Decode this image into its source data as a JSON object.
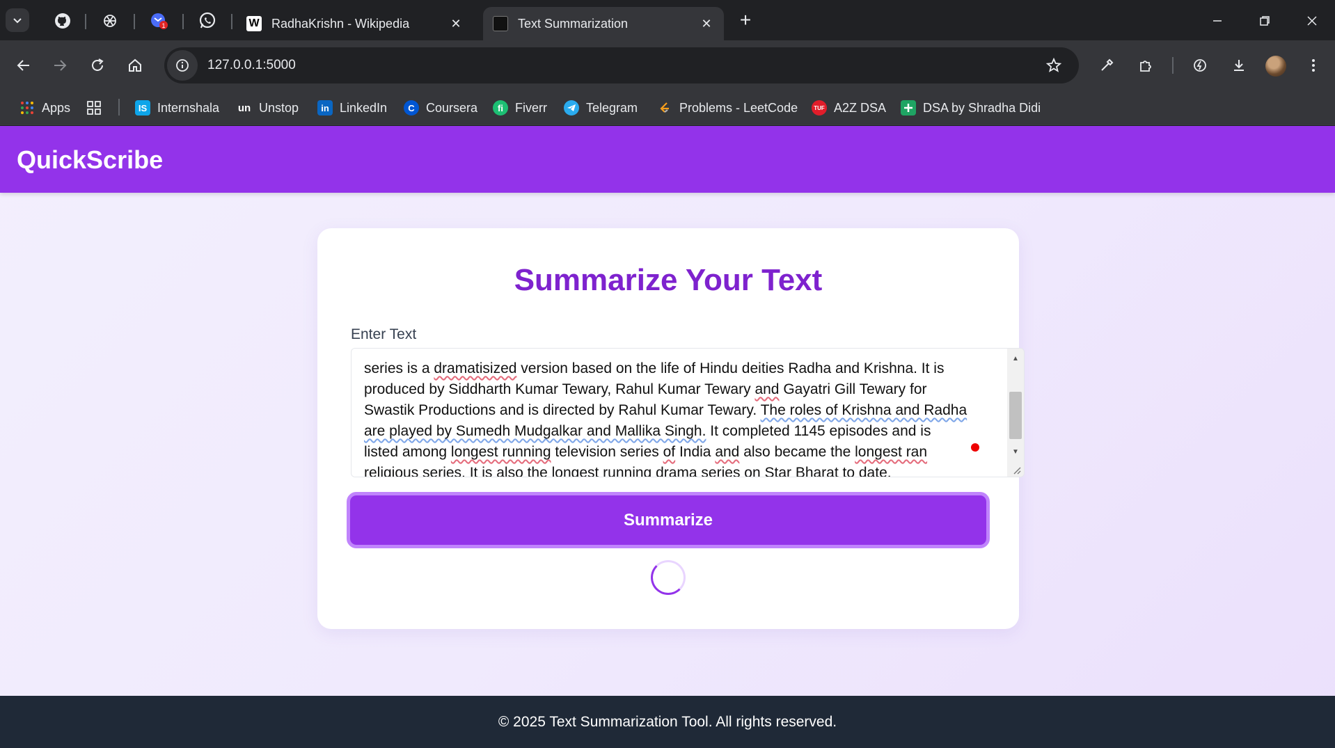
{
  "browser": {
    "tabs": [
      {
        "title": "RadhaKrishn - Wikipedia",
        "favicon": "wikipedia-icon"
      },
      {
        "title": "Text Summarization",
        "favicon": "page-icon"
      }
    ],
    "pinned_tabs": [
      "github-icon",
      "chatgpt-icon",
      "mail-icon",
      "whatsapp-icon"
    ],
    "url": "127.0.0.1:5000",
    "bookmarks": [
      {
        "label": "Apps",
        "icon": "apps-grid-icon"
      },
      {
        "label": "Internshala",
        "icon": "internshala-icon"
      },
      {
        "label": "Unstop",
        "icon": "unstop-icon"
      },
      {
        "label": "LinkedIn",
        "icon": "linkedin-icon"
      },
      {
        "label": "Coursera",
        "icon": "coursera-icon"
      },
      {
        "label": "Fiverr",
        "icon": "fiverr-icon"
      },
      {
        "label": "Telegram",
        "icon": "telegram-icon"
      },
      {
        "label": "Problems - LeetCode",
        "icon": "leetcode-icon"
      },
      {
        "label": "A2Z DSA",
        "icon": "tuf-icon"
      },
      {
        "label": "DSA by Shradha Didi",
        "icon": "sheets-icon"
      }
    ]
  },
  "app": {
    "brand": "QuickScribe",
    "title": "Summarize Your Text",
    "input_label": "Enter Text",
    "text_lines": [
      [
        "series is a ",
        "dramatisized",
        " version based on the life of Hindu deities Radha and Krishna. It is"
      ],
      [
        "produced by Siddharth Kumar Tewary, Rahul Kumar Tewary ",
        "and",
        " Gayatri Gill Tewary for"
      ],
      [
        "Swastik Productions and is directed by Rahul Kumar Tewary. ",
        "The roles of Krishna and Radha",
        ""
      ],
      [
        "are played by Sumedh Mudgalkar and Mallika Singh.",
        " It completed 1145 episodes and is"
      ],
      [
        "listed among ",
        "longest running",
        " television series ",
        "of",
        " India ",
        "and",
        " also became the ",
        "longest ran",
        ""
      ],
      [
        "religious series. It is also the ",
        "longest running",
        " drama series on Star Bharat to date."
      ]
    ],
    "submit_label": "Summarize",
    "loading": true,
    "footer": "© 2025 Text Summarization Tool. All rights reserved."
  },
  "colors": {
    "header": "#9333ea",
    "title": "#7e22ce",
    "button": "#9333ea",
    "button_ring": "#c084fc",
    "footer": "#1f2937"
  }
}
